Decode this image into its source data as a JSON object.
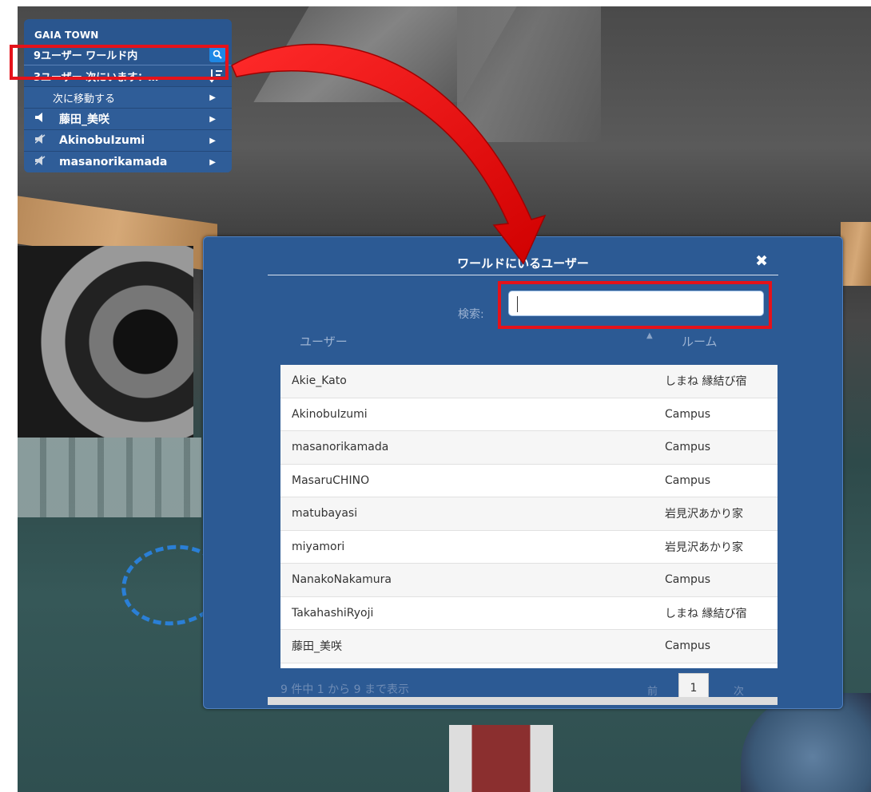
{
  "menu": {
    "app_title": "GAIA TOWN",
    "users_in_world": "9ユーザー ワールド内",
    "nearby": "3ユーザー 次にいます：…",
    "move_to": "次に移動する",
    "people": [
      {
        "name": "藤田_美咲",
        "audio": "speaker-icon"
      },
      {
        "name": "AkinobuIzumi",
        "audio": "speaker-muted-icon"
      },
      {
        "name": "masanorikamada",
        "audio": "speaker-muted-icon"
      }
    ]
  },
  "dialog": {
    "title": "ワールドにいるユーザー",
    "search_label": "検索:",
    "search_value": "",
    "columns": {
      "user": "ユーザー",
      "room": "ルーム"
    },
    "rows": [
      {
        "user": "Akie_Kato",
        "room": "しまね 縁結び宿"
      },
      {
        "user": "AkinobuIzumi",
        "room": "Campus"
      },
      {
        "user": "masanorikamada",
        "room": "Campus"
      },
      {
        "user": "MasaruCHINO",
        "room": "Campus"
      },
      {
        "user": "matubayasi",
        "room": "岩見沢あかり家"
      },
      {
        "user": "miyamori",
        "room": "岩見沢あかり家"
      },
      {
        "user": "NanakoNakamura",
        "room": "Campus"
      },
      {
        "user": "TakahashiRyoji",
        "room": "しまね 縁結び宿"
      },
      {
        "user": "藤田_美咲",
        "room": "Campus"
      }
    ],
    "info": "9 件中 1 から 9 まで表示",
    "prev": "前",
    "page": "1",
    "next": "次"
  },
  "colors": {
    "panel": "#2c5a94",
    "highlight": "#e5121a",
    "accent": "#1e88e5"
  }
}
